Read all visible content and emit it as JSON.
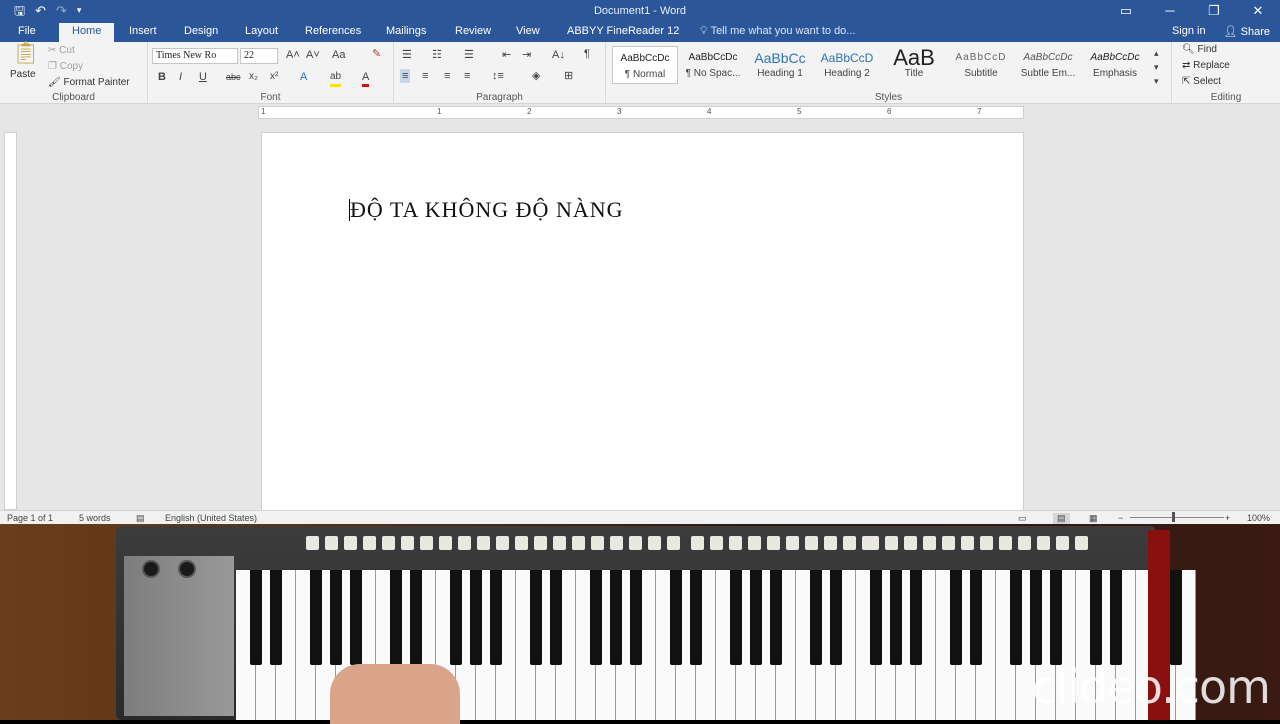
{
  "titlebar": {
    "title": "Document1 - Word",
    "save": "🖫",
    "undo": "↶",
    "redo": "↷",
    "customize": "▾",
    "ribbon_opts": "▭",
    "minimize": "─",
    "restore": "❐",
    "close": "✕"
  },
  "tabs": [
    {
      "label": "File"
    },
    {
      "label": "Home"
    },
    {
      "label": "Insert"
    },
    {
      "label": "Design"
    },
    {
      "label": "Layout"
    },
    {
      "label": "References"
    },
    {
      "label": "Mailings"
    },
    {
      "label": "Review"
    },
    {
      "label": "View"
    },
    {
      "label": "ABBYY FineReader 12"
    }
  ],
  "tell_me": "Tell me what you want to do...",
  "sign_in": "Sign in",
  "share": "Share",
  "clipboard": {
    "label": "Clipboard",
    "paste": "Paste",
    "cut": "Cut",
    "copy": "Copy",
    "format_painter": "Format Painter"
  },
  "font": {
    "label": "Font",
    "name": "Times New Ro",
    "size": "22",
    "bold": "B",
    "italic": "I",
    "underline": "U",
    "strike": "abc",
    "sub": "x₂",
    "sup": "x²",
    "grow": "A˄",
    "shrink": "A˅",
    "case": "Aa",
    "text_effects": "A",
    "highlight": "ab",
    "font_color": "A"
  },
  "paragraph": {
    "label": "Paragraph",
    "pilcrow": "¶",
    "sort": "A↓"
  },
  "styles": {
    "label": "Styles",
    "items": [
      {
        "preview": "AaBbCcDc",
        "label": "¶ Normal"
      },
      {
        "preview": "AaBbCcDc",
        "label": "¶ No Spac..."
      },
      {
        "preview": "AaBbCc",
        "label": "Heading 1"
      },
      {
        "preview": "AaBbCcD",
        "label": "Heading 2"
      },
      {
        "preview": "AaB",
        "label": "Title"
      },
      {
        "preview": "AaBbCcD",
        "label": "Subtitle"
      },
      {
        "preview": "AaBbCcDc",
        "label": "Subtle Em..."
      },
      {
        "preview": "AaBbCcDc",
        "label": "Emphasis"
      }
    ]
  },
  "editing": {
    "label": "Editing",
    "find": "Find",
    "replace": "Replace",
    "select": "Select"
  },
  "ruler": {
    "marks": [
      "1",
      "1",
      "2",
      "3",
      "4",
      "5",
      "6",
      "7"
    ]
  },
  "document": {
    "text": "ĐỘ TA KHÔNG ĐỘ NÀNG"
  },
  "status": {
    "page": "Page 1 of 1",
    "words": "5 words",
    "language": "English (United States)",
    "zoom": "100%"
  },
  "watermark": "clideo.com"
}
